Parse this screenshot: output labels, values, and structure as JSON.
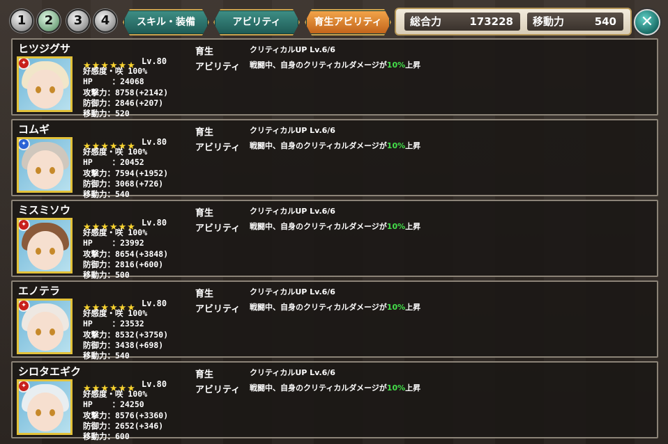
{
  "top": {
    "party_numbers": [
      "1",
      "2",
      "3",
      "4"
    ],
    "active_party": 1,
    "tabs": [
      {
        "label": "スキル・装備",
        "active": false
      },
      {
        "label": "アビリティ",
        "active": false
      },
      {
        "label": "育生アビリティ",
        "active": true
      }
    ],
    "total_power_label": "総合力",
    "total_power_value": "173228",
    "move_label": "移動力",
    "move_value": "540",
    "close_symbol": "✕"
  },
  "labels": {
    "growth": "育生",
    "ability": "アビリティ",
    "affinity": "好感度・咲 100%",
    "hp": "HP",
    "atk": "攻撃力",
    "def": "防御力",
    "mov": "移動力",
    "desc_prefix": "戦闘中、自身のクリティカルダメージが",
    "desc_pct": "10%",
    "desc_suffix": "上昇"
  },
  "characters": [
    {
      "name": "ヒツジグサ",
      "level": "Lv.80",
      "stars": 6,
      "hp": "24068",
      "atk": "8758(+2142)",
      "def": "2846(+207)",
      "mov": "520",
      "skill": "クリティカルUP Lv.6/6",
      "element": "red",
      "hair": "#f1e6c9"
    },
    {
      "name": "コムギ",
      "level": "Lv.80",
      "stars": 6,
      "hp": "20452",
      "atk": "7594(+1952)",
      "def": "3068(+726)",
      "mov": "540",
      "skill": "クリティカルUP Lv.6/6",
      "element": "blue",
      "hair": "#cfc7bd"
    },
    {
      "name": "ミスミソウ",
      "level": "Lv.80",
      "stars": 6,
      "hp": "23992",
      "atk": "8654(+3848)",
      "def": "2816(+600)",
      "mov": "500",
      "skill": "クリティカルUP Lv.6/6",
      "element": "red",
      "hair": "#8a5a3a"
    },
    {
      "name": "エノテラ",
      "level": "Lv.80",
      "stars": 6,
      "hp": "23532",
      "atk": "8532(+3750)",
      "def": "3438(+698)",
      "mov": "540",
      "skill": "クリティカルUP Lv.6/6",
      "element": "red",
      "hair": "#eee8e2"
    },
    {
      "name": "シロタエギク",
      "level": "Lv.80",
      "stars": 6,
      "hp": "24250",
      "atk": "8576(+3360)",
      "def": "2652(+346)",
      "mov": "600",
      "skill": "クリティカルUP Lv.6/6",
      "element": "red",
      "hair": "#e8eef1"
    }
  ]
}
